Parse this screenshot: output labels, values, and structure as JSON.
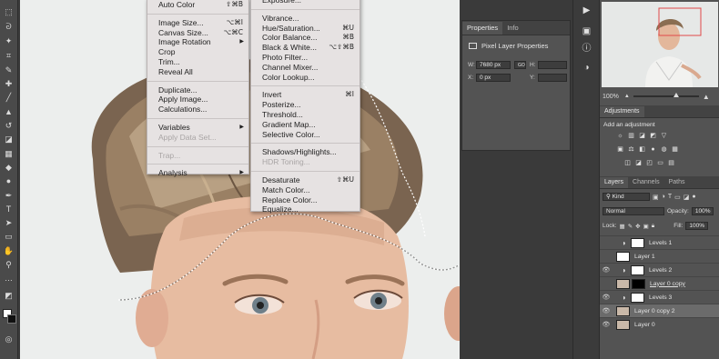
{
  "image_menu": {
    "items": [
      {
        "label": "Auto Color",
        "shortcut": "⇧⌘B",
        "disabled": false,
        "submenu": false
      },
      {
        "sep": true
      },
      {
        "label": "Image Size...",
        "shortcut": "⌥⌘I",
        "disabled": false,
        "submenu": false
      },
      {
        "label": "Canvas Size...",
        "shortcut": "⌥⌘C",
        "disabled": false,
        "submenu": false
      },
      {
        "label": "Image Rotation",
        "shortcut": "",
        "disabled": false,
        "submenu": true
      },
      {
        "label": "Crop",
        "shortcut": "",
        "disabled": false,
        "submenu": false
      },
      {
        "label": "Trim...",
        "shortcut": "",
        "disabled": false,
        "submenu": false
      },
      {
        "label": "Reveal All",
        "shortcut": "",
        "disabled": false,
        "submenu": false
      },
      {
        "sep": true
      },
      {
        "label": "Duplicate...",
        "shortcut": "",
        "disabled": false,
        "submenu": false
      },
      {
        "label": "Apply Image...",
        "shortcut": "",
        "disabled": false,
        "submenu": false
      },
      {
        "label": "Calculations...",
        "shortcut": "",
        "disabled": false,
        "submenu": false
      },
      {
        "sep": true
      },
      {
        "label": "Variables",
        "shortcut": "",
        "disabled": false,
        "submenu": true
      },
      {
        "label": "Apply Data Set...",
        "shortcut": "",
        "disabled": true,
        "submenu": false
      },
      {
        "sep": true
      },
      {
        "label": "Trap...",
        "shortcut": "",
        "disabled": true,
        "submenu": false
      },
      {
        "sep": true
      },
      {
        "label": "Analysis",
        "shortcut": "",
        "disabled": false,
        "submenu": true
      }
    ]
  },
  "adjustments_menu": {
    "items": [
      {
        "label": "Exposure...",
        "shortcut": ""
      },
      {
        "sep": true
      },
      {
        "label": "Vibrance...",
        "shortcut": ""
      },
      {
        "label": "Hue/Saturation...",
        "shortcut": "⌘U"
      },
      {
        "label": "Color Balance...",
        "shortcut": "⌘B"
      },
      {
        "label": "Black & White...",
        "shortcut": "⌥⇧⌘B"
      },
      {
        "label": "Photo Filter...",
        "shortcut": ""
      },
      {
        "label": "Channel Mixer...",
        "shortcut": ""
      },
      {
        "label": "Color Lookup...",
        "shortcut": ""
      },
      {
        "sep": true
      },
      {
        "label": "Invert",
        "shortcut": "⌘I"
      },
      {
        "label": "Posterize...",
        "shortcut": ""
      },
      {
        "label": "Threshold...",
        "shortcut": ""
      },
      {
        "label": "Gradient Map...",
        "shortcut": ""
      },
      {
        "label": "Selective Color...",
        "shortcut": ""
      },
      {
        "sep": true
      },
      {
        "label": "Shadows/Highlights...",
        "shortcut": ""
      },
      {
        "label": "HDR Toning...",
        "shortcut": "",
        "disabled": true
      },
      {
        "sep": true
      },
      {
        "label": "Desaturate",
        "shortcut": "⇧⌘U"
      },
      {
        "label": "Match Color...",
        "shortcut": ""
      },
      {
        "label": "Replace Color...",
        "shortcut": ""
      },
      {
        "label": "Equalize...",
        "shortcut": ""
      }
    ]
  },
  "properties_panel": {
    "tab_properties": "Properties",
    "tab_info": "Info",
    "title": "Pixel Layer Properties",
    "w_label": "W:",
    "w_value": "7680 px",
    "link_label": "GO",
    "h_label": "H:",
    "x_label": "X:",
    "x_value": "0 px",
    "y_label": "Y:"
  },
  "navigator": {
    "zoom": "100%"
  },
  "adjustments_panel": {
    "tab": "Adjustments",
    "heading": "Add an adjustment"
  },
  "layers_panel": {
    "tabs": [
      "Layers",
      "Channels",
      "Paths"
    ],
    "filter": "Kind",
    "blend_mode": "Normal",
    "opacity_label": "Opacity:",
    "opacity_value": "100%",
    "lock_label": "Lock:",
    "fill_label": "Fill:",
    "fill_value": "100%",
    "layers": [
      {
        "name": "Levels 1",
        "visible": false,
        "adjustment": true,
        "selected": false,
        "underline": false
      },
      {
        "name": "Layer 1",
        "visible": false,
        "adjustment": false,
        "selected": false,
        "underline": false
      },
      {
        "name": "Levels 2",
        "visible": true,
        "adjustment": true,
        "selected": false,
        "underline": false
      },
      {
        "name": "Layer 0 copy",
        "visible": false,
        "adjustment": false,
        "selected": false,
        "underline": true
      },
      {
        "name": "Levels 3",
        "visible": true,
        "adjustment": true,
        "selected": false,
        "underline": false
      },
      {
        "name": "Layer 0 copy 2",
        "visible": true,
        "adjustment": false,
        "selected": true,
        "underline": false
      },
      {
        "name": "Layer 0",
        "visible": true,
        "adjustment": false,
        "selected": false,
        "underline": false
      }
    ]
  },
  "colors": {
    "ui_dark": "#3a3a3a",
    "panel": "#535353",
    "menu_bg": "#e6e2e2",
    "selection_row": "#6b6b6b"
  }
}
